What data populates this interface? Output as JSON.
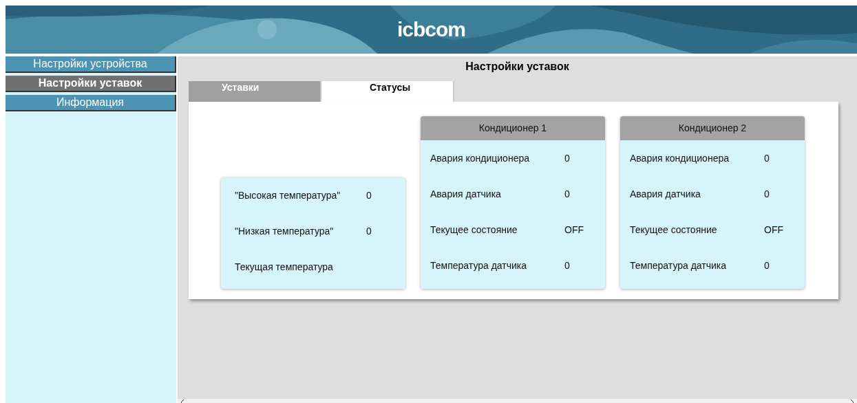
{
  "header": {
    "logo": "icbcom"
  },
  "sidebar": {
    "items": [
      {
        "label": "Настройки устройства",
        "selected": false
      },
      {
        "label": "Настройки уставок",
        "selected": true
      },
      {
        "label": "Информация",
        "selected": false
      }
    ]
  },
  "page_title": "Настройки уставок",
  "tabs": [
    {
      "label": "Уставки",
      "selected": false
    },
    {
      "label": "Статусы",
      "selected": true
    }
  ],
  "cards": [
    {
      "rows": [
        {
          "label": "\"Высокая температура\"",
          "value": "0"
        },
        {
          "label": "\"Низкая температура\"",
          "value": "0"
        },
        {
          "label": "Текущая температура"
        }
      ]
    },
    {
      "title": "Кондиционер 1",
      "rows": [
        {
          "label": "Авария кондиционера",
          "value": "0"
        },
        {
          "label": "Авария датчика",
          "value": "0"
        },
        {
          "label": "Текущее состояние",
          "value": "OFF"
        },
        {
          "label": "Температура датчика",
          "value": "0"
        }
      ]
    },
    {
      "title": "Кондиционер 2",
      "rows": [
        {
          "label": "Авария кондиционера",
          "value": "0"
        },
        {
          "label": "Авария датчика",
          "value": "0"
        },
        {
          "label": "Текущее состояние",
          "value": "OFF"
        },
        {
          "label": "Температура датчика",
          "value": "0"
        }
      ]
    }
  ]
}
